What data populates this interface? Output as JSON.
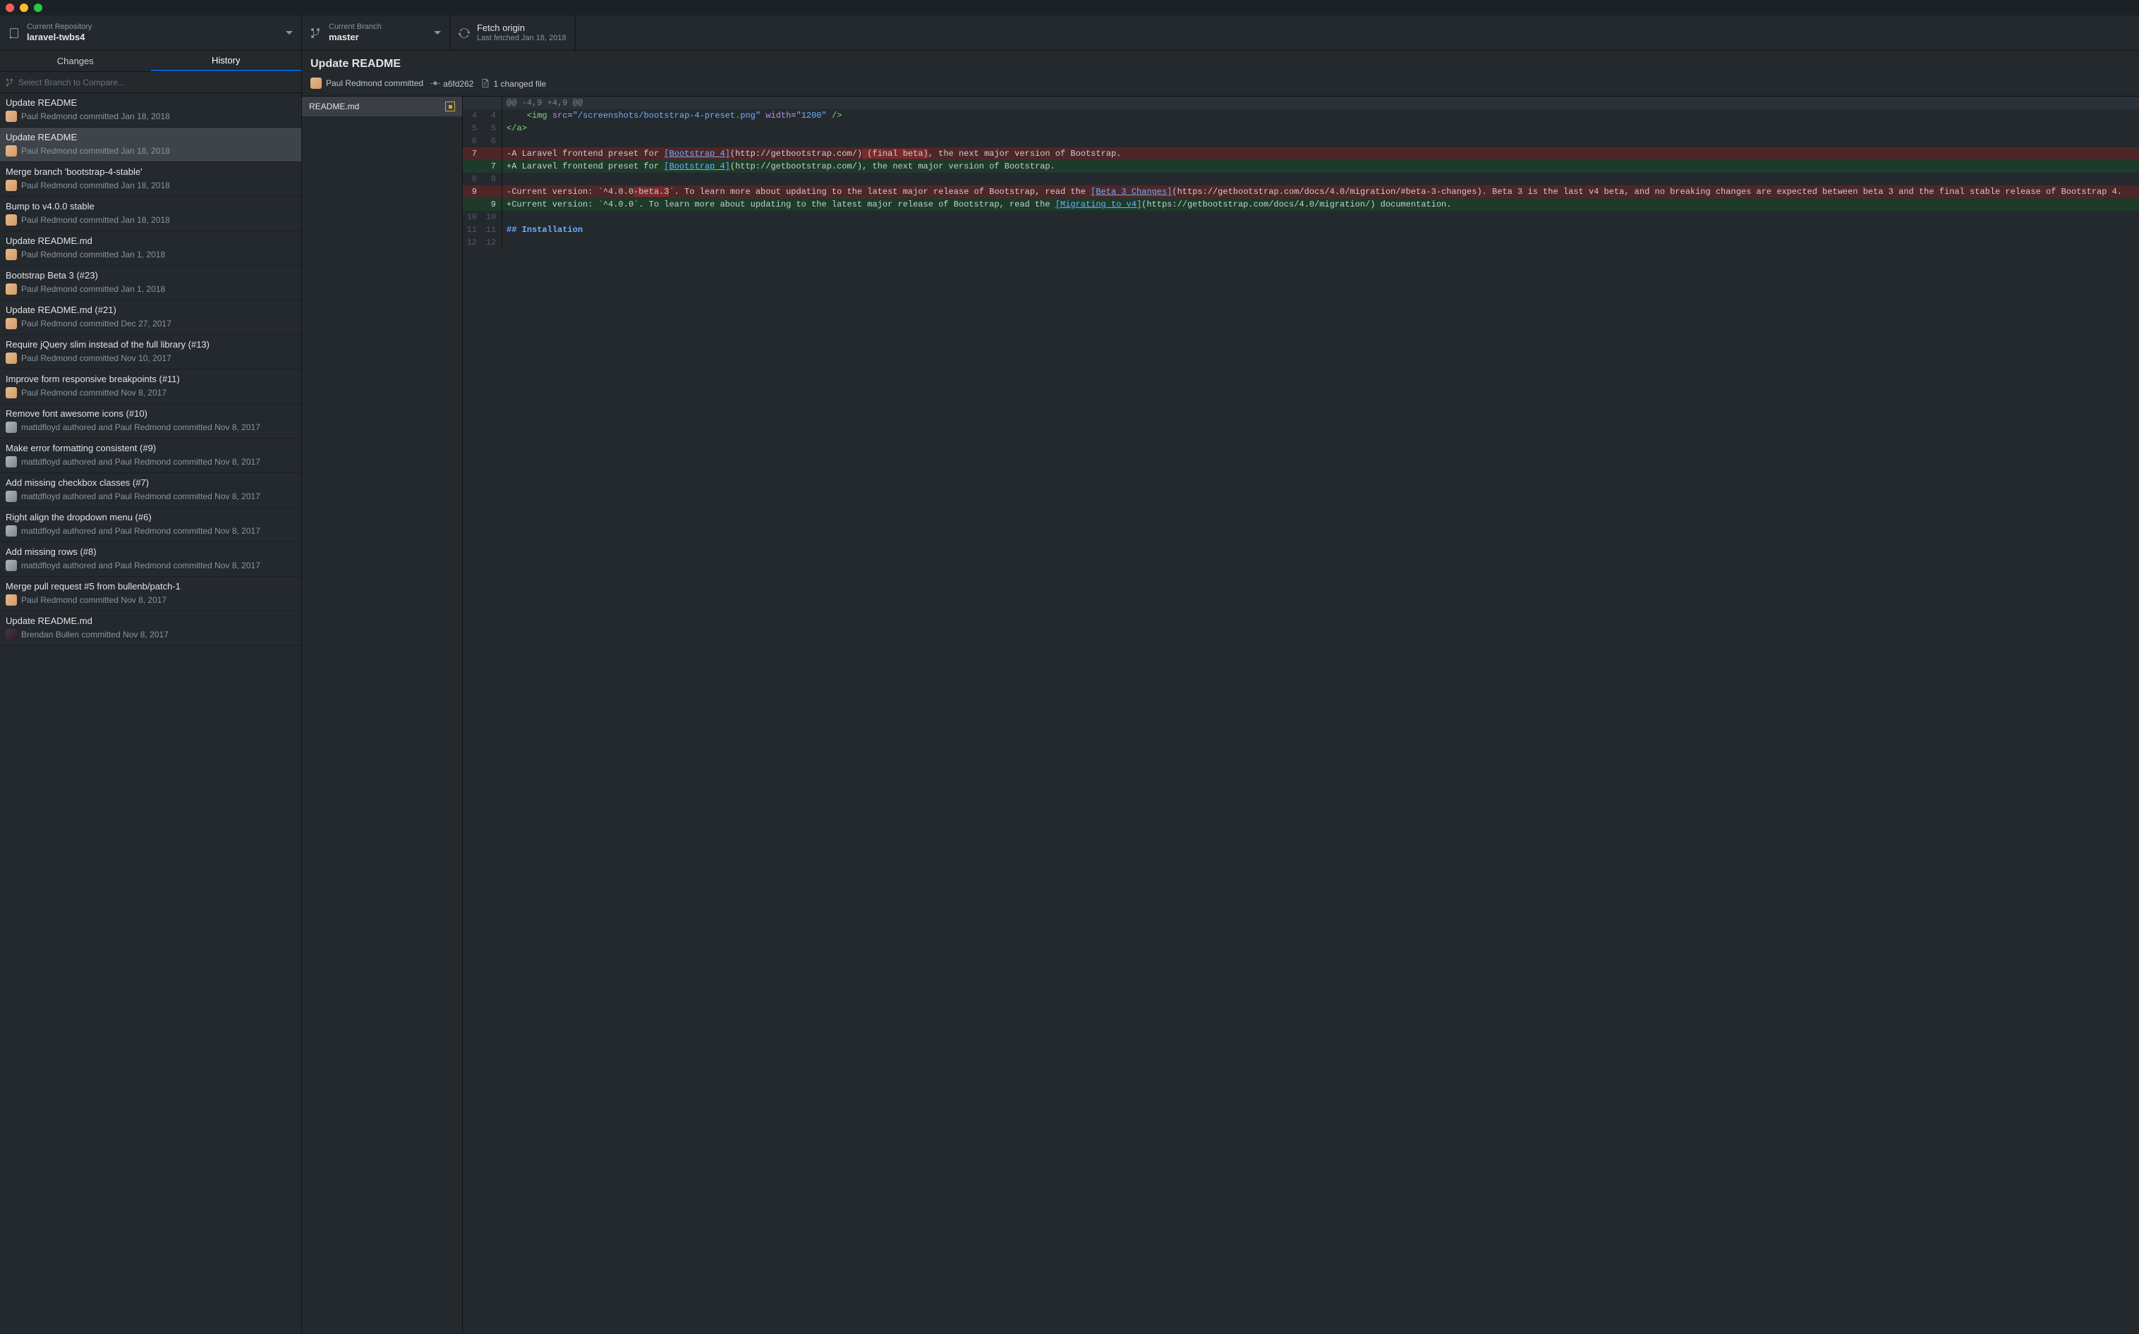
{
  "toolbar": {
    "repo": {
      "label": "Current Repository",
      "value": "laravel-twbs4"
    },
    "branch": {
      "label": "Current Branch",
      "value": "master"
    },
    "fetch": {
      "label": "Fetch origin",
      "value": "Last fetched Jan 18, 2018"
    }
  },
  "tabs": {
    "changes": "Changes",
    "history": "History"
  },
  "compare": {
    "placeholder": "Select Branch to Compare..."
  },
  "commits": [
    {
      "title": "Update README",
      "meta": "Paul Redmond committed Jan 18, 2018",
      "avatar": "a",
      "sel": false
    },
    {
      "title": "Update README",
      "meta": "Paul Redmond committed Jan 18, 2018",
      "avatar": "a",
      "sel": true
    },
    {
      "title": "Merge branch 'bootstrap-4-stable'",
      "meta": "Paul Redmond committed Jan 18, 2018",
      "avatar": "a",
      "sel": false
    },
    {
      "title": "Bump to v4.0.0 stable",
      "meta": "Paul Redmond committed Jan 18, 2018",
      "avatar": "a",
      "sel": false
    },
    {
      "title": "Update README.md",
      "meta": "Paul Redmond committed Jan 1, 2018",
      "avatar": "a",
      "sel": false
    },
    {
      "title": "Bootstrap Beta 3 (#23)",
      "meta": "Paul Redmond committed Jan 1, 2018",
      "avatar": "a",
      "sel": false
    },
    {
      "title": "Update README.md (#21)",
      "meta": "Paul Redmond committed Dec 27, 2017",
      "avatar": "a",
      "sel": false
    },
    {
      "title": "Require jQuery slim instead of the full library (#13)",
      "meta": "Paul Redmond committed Nov 10, 2017",
      "avatar": "a",
      "sel": false
    },
    {
      "title": "Improve form responsive breakpoints (#11)",
      "meta": "Paul Redmond committed Nov 8, 2017",
      "avatar": "a",
      "sel": false
    },
    {
      "title": "Remove font awesome icons (#10)",
      "meta": "mattdfloyd authored and Paul Redmond committed Nov 8, 2017",
      "avatar": "b",
      "sel": false
    },
    {
      "title": "Make error formatting consistent (#9)",
      "meta": "mattdfloyd authored and Paul Redmond committed Nov 8, 2017",
      "avatar": "b",
      "sel": false
    },
    {
      "title": "Add missing checkbox classes (#7)",
      "meta": "mattdfloyd authored and Paul Redmond committed Nov 8, 2017",
      "avatar": "b",
      "sel": false
    },
    {
      "title": "Right align the dropdown menu (#6)",
      "meta": "mattdfloyd authored and Paul Redmond committed Nov 8, 2017",
      "avatar": "b",
      "sel": false
    },
    {
      "title": "Add missing rows (#8)",
      "meta": "mattdfloyd authored and Paul Redmond committed Nov 8, 2017",
      "avatar": "b",
      "sel": false
    },
    {
      "title": "Merge pull request #5 from bullenb/patch-1",
      "meta": "Paul Redmond committed Nov 8, 2017",
      "avatar": "a",
      "sel": false
    },
    {
      "title": "Update README.md",
      "meta": "Brendan Bullen committed Nov 8, 2017",
      "avatar": "c",
      "sel": false
    }
  ],
  "detail": {
    "title": "Update README",
    "author": "Paul Redmond committed",
    "sha": "a6fd262",
    "changed": "1 changed file",
    "file": "README.md"
  },
  "diff": {
    "hunk": "@@ -4,9 +4,9 @@",
    "l4": "    <img src=\"/screenshots/bootstrap-4-preset.png\" width=\"1200\" />",
    "l5": "</a>",
    "l6": "",
    "l7del_pre": "-A Laravel frontend preset for ",
    "l7del_link": "[Bootstrap 4]",
    "l7del_url": "(http://getbootstrap.com/)",
    "l7del_final": " (final beta)",
    "l7del_post": ", the next major version of Bootstrap.",
    "l7add_pre": "+A Laravel frontend preset for ",
    "l7add_link": "[Bootstrap 4]",
    "l7add_url": "(http://getbootstrap.com/)",
    "l7add_post": ", the next major version of Bootstrap.",
    "l8": "",
    "l9del_pre": "-Current version: `^4.0.0",
    "l9del_beta": "-beta.3",
    "l9del_post1": "`. To learn more about updating to the latest major release of Bootstrap, read the ",
    "l9del_link": "[Beta 3 Changes]",
    "l9del_post2": "(https://getbootstrap.com/docs/4.0/migration/#beta-3-changes). Beta 3 is the last v4 beta, and no breaking changes are expected between beta 3 and the final stable release of Bootstrap 4.",
    "l9add_pre": "+Current version: `^4.0.0`. To learn more about updating to the latest major release of Bootstrap, read the ",
    "l9add_link": "[Migrating to v4]",
    "l9add_post": "(https://getbootstrap.com/docs/4.0/migration/) documentation.",
    "l10": "",
    "l11": "## Installation",
    "l12": ""
  }
}
